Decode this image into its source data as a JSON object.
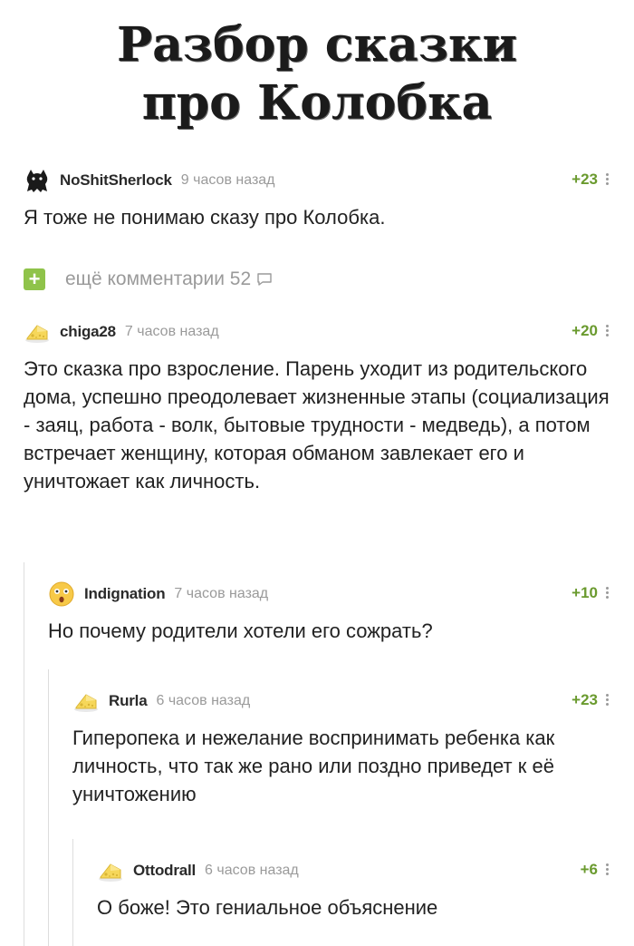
{
  "title": {
    "line1": "Разбор сказки",
    "line2": "про Колобка"
  },
  "more_comments": {
    "plus": "+",
    "label": "ещё комментарии 52",
    "icon": "comment-bubble-icon"
  },
  "comments": [
    {
      "username": "NoShitSherlock",
      "time": "9 часов назад",
      "rating": "+23",
      "avatar_icon": "cat-avatar-icon",
      "text": "Я тоже не понимаю сказу про Колобка."
    },
    {
      "username": "chiga28",
      "time": "7 часов назад",
      "rating": "+20",
      "avatar_icon": "cheese-avatar-icon",
      "text": "Это сказка про взросление. Парень уходит из родительского дома, успешно преодолевает жизненные этапы (социализация - заяц, работа - волк, бытовые трудности - медведь), а потом встречает женщину, которая обманом завлекает его и уничтожает как личность."
    },
    {
      "username": "Indignation",
      "time": "7 часов назад",
      "rating": "+10",
      "avatar_icon": "surprised-face-avatar-icon",
      "text": "Но почему родители хотели его сожрать?"
    },
    {
      "username": "Rurla",
      "time": "6 часов назад",
      "rating": "+23",
      "avatar_icon": "cheese-avatar-icon",
      "text": "Гиперопека и нежелание воспринимать ребенка как личность, что так же рано или поздно приведет к её уничтожению"
    },
    {
      "username": "Ottodrall",
      "time": "6 часов назад",
      "rating": "+6",
      "avatar_icon": "cheese-avatar-icon",
      "text": "О боже! Это гениальное объяснение"
    }
  ],
  "colors": {
    "rating_green": "#6a9a2e",
    "plus_green": "#8fc34a",
    "muted_gray": "#9a9a9a"
  }
}
